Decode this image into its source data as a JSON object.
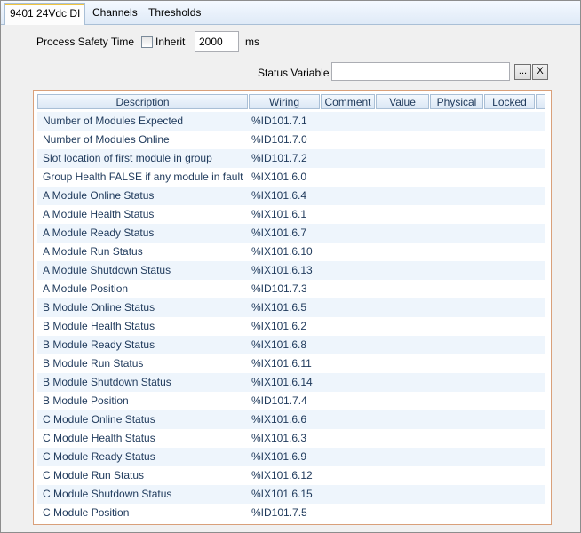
{
  "tabs": [
    {
      "label": "9401 24Vdc DI",
      "active": true
    },
    {
      "label": "Channels"
    },
    {
      "label": "Thresholds"
    }
  ],
  "form": {
    "process_safety_time_label": "Process Safety Time",
    "inherit_label": "Inherit",
    "inherit_checked": false,
    "pst_value": "2000",
    "pst_unit": "ms",
    "status_variable_label": "Status Variable",
    "status_variable_value": "",
    "browse_label": "...",
    "clear_label": "X"
  },
  "grid": {
    "columns": [
      "Description",
      "Wiring",
      "Comment",
      "Value",
      "Physical",
      "Locked"
    ],
    "rows": [
      {
        "description": "Number of Modules Expected",
        "wiring": "%ID101.7.1"
      },
      {
        "description": "Number of Modules Online",
        "wiring": "%ID101.7.0"
      },
      {
        "description": "Slot location of first module in group",
        "wiring": "%ID101.7.2"
      },
      {
        "description": "Group Health FALSE if any module in fault",
        "wiring": "%IX101.6.0"
      },
      {
        "description": "A Module Online Status",
        "wiring": "%IX101.6.4"
      },
      {
        "description": "A Module Health Status",
        "wiring": "%IX101.6.1"
      },
      {
        "description": "A Module Ready Status",
        "wiring": "%IX101.6.7"
      },
      {
        "description": "A Module Run Status",
        "wiring": "%IX101.6.10"
      },
      {
        "description": "A Module Shutdown Status",
        "wiring": "%IX101.6.13"
      },
      {
        "description": "A Module Position",
        "wiring": "%ID101.7.3"
      },
      {
        "description": "B Module Online Status",
        "wiring": "%IX101.6.5"
      },
      {
        "description": "B Module Health Status",
        "wiring": "%IX101.6.2"
      },
      {
        "description": "B Module Ready Status",
        "wiring": "%IX101.6.8"
      },
      {
        "description": "B Module Run Status",
        "wiring": "%IX101.6.11"
      },
      {
        "description": "B Module Shutdown Status",
        "wiring": "%IX101.6.14"
      },
      {
        "description": "B Module Position",
        "wiring": "%ID101.7.4"
      },
      {
        "description": "C Module Online Status",
        "wiring": "%IX101.6.6"
      },
      {
        "description": "C Module Health Status",
        "wiring": "%IX101.6.3"
      },
      {
        "description": "C Module Ready Status",
        "wiring": "%IX101.6.9"
      },
      {
        "description": "C Module Run Status",
        "wiring": "%IX101.6.12"
      },
      {
        "description": "C Module Shutdown Status",
        "wiring": "%IX101.6.15"
      },
      {
        "description": "C Module Position",
        "wiring": "%ID101.7.5"
      }
    ]
  }
}
